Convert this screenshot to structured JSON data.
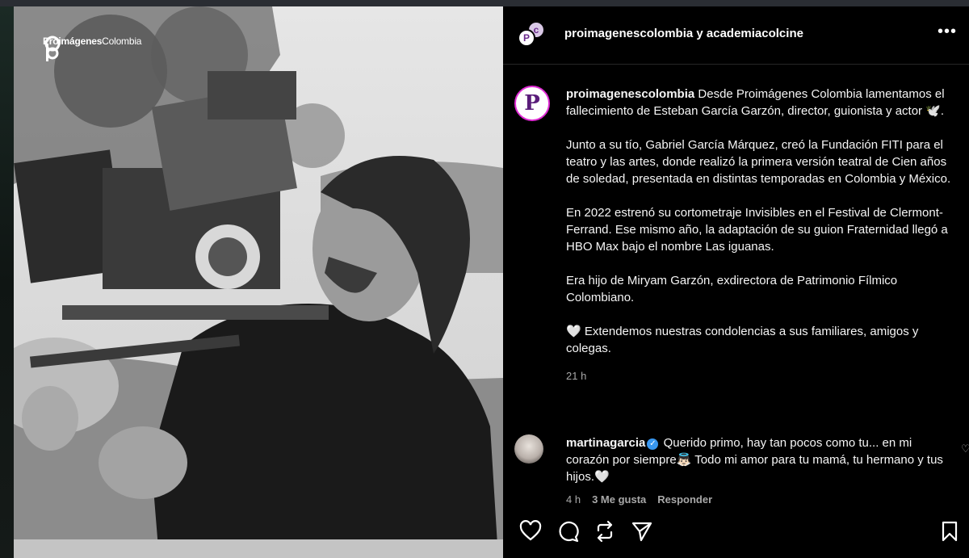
{
  "brand": {
    "name_bold": "Proimágenes",
    "name_light": "Colombia"
  },
  "header": {
    "title": "proimagenescolombia y academiacolcine",
    "more_label": "•••"
  },
  "caption": {
    "username": "proimagenescolombia",
    "p1": "Desde Proimágenes Colombia lamentamos el fallecimiento de Esteban García Garzón, director, guionista y actor 🕊️.",
    "p2": "Junto a su tío, Gabriel García Márquez, creó la Fundación FITI para el teatro y las artes, donde realizó la primera versión teatral de Cien años de soledad, presentada en distintas temporadas en Colombia y México.",
    "p3": "En 2022 estrenó su cortometraje Invisibles en el Festival de Clermont-Ferrand. Ese mismo año, la adaptación de su guion Fraternidad llegó a HBO Max bajo el nombre Las iguanas.",
    "p4": "Era hijo de Miryam Garzón, exdirectora de Patrimonio Fílmico Colombiano.",
    "p5": "🤍  Extendemos nuestras condolencias a sus familiares, amigos y colegas.",
    "time": "21 h"
  },
  "comment": {
    "username": "martinagarcia",
    "text": "Querido primo, hay tan pocos como tu... en mi corazón por siempre👼🏻 Todo mi amor para tu mamá, tu hermano y tus hijos.🤍",
    "time": "4 h",
    "likes": "3 Me gusta",
    "reply": "Responder"
  },
  "icons": [
    "heart-icon",
    "comment-icon",
    "repost-icon",
    "share-icon",
    "bookmark-icon"
  ]
}
